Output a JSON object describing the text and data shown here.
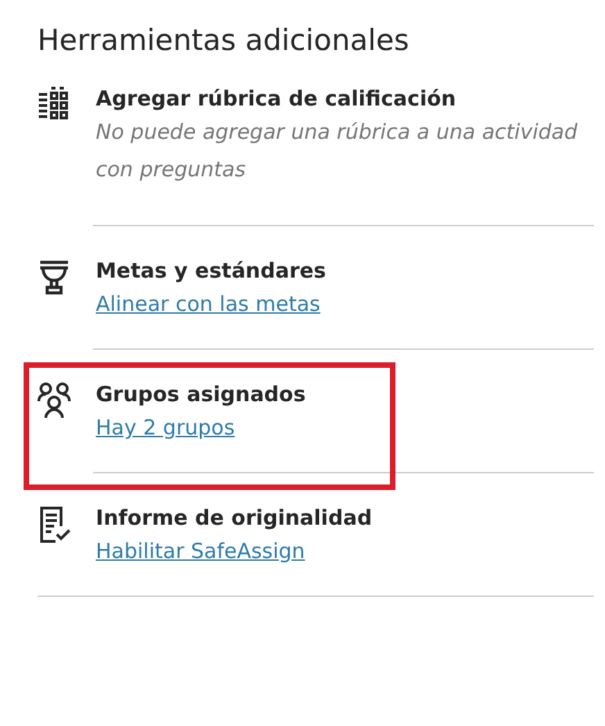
{
  "heading": "Herramientas adicionales",
  "tools": [
    {
      "title": "Agregar rúbrica de calificación",
      "kind": "note",
      "detail": "No puede agregar una rúbrica a una actividad con preguntas",
      "highlighted": false
    },
    {
      "title": "Metas y estándares",
      "kind": "link",
      "detail": "Alinear con las metas",
      "highlighted": false
    },
    {
      "title": "Grupos asignados",
      "kind": "link",
      "detail": "Hay 2 grupos",
      "highlighted": true
    },
    {
      "title": "Informe de originalidad",
      "kind": "link",
      "detail": "Habilitar SafeAssign",
      "highlighted": false
    }
  ]
}
